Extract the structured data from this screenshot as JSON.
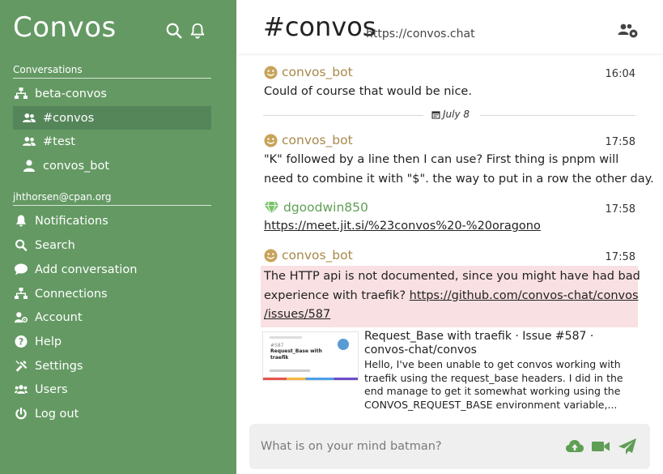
{
  "sidebar": {
    "logo": "Convos",
    "conversations_heading": "Conversations",
    "connection": "beta-convos",
    "conversations": [
      {
        "label": "#convos",
        "active": true
      },
      {
        "label": "#test",
        "active": false
      },
      {
        "label": "convos_bot",
        "active": false
      }
    ],
    "account_heading": "jhthorsen@cpan.org",
    "menu": [
      "Notifications",
      "Search",
      "Add conversation",
      "Connections",
      "Account",
      "Help",
      "Settings",
      "Users",
      "Log out"
    ]
  },
  "header": {
    "title": "#convos",
    "topic": "https://convos.chat"
  },
  "messages": [
    {
      "author": "convos_bot",
      "time": "16:04",
      "text": "Could of course that would be nice."
    },
    {
      "author": "convos_bot",
      "time": "17:58",
      "text_line1": "\"K\" followed by a line then I can use? First thing is pnpm will",
      "text_line2": "need to combine it with \"$\". the way to put in a row the other day."
    },
    {
      "author": "dgoodwin850",
      "time": "17:58",
      "link": "https://meet.jit.si/%23convos%20-%20oragono"
    },
    {
      "author": "convos_bot",
      "time": "17:58",
      "text_line1": "The HTTP api is not documented, since you might have had bad",
      "text_line2_prefix": "experience with traefik? ",
      "link_part1": "https://github.com/convos-chat/convos",
      "link_part2": "/issues/587"
    }
  ],
  "day_separator": "July 8",
  "preview": {
    "title": "Request_Base with traefik · Issue #587 · convos-chat/convos",
    "description": "Hello, I've been unable to get convos working with traefik using the request_base headers. I did in the end manage to get it somewhat working using the CONVOS_REQUEST_BASE environment variable,...",
    "thumb_number": "#587",
    "thumb_title": "Request_Base with traefik"
  },
  "composer": {
    "placeholder": "What is on your mind batman?"
  },
  "colors": {
    "sidebar_bg": "#649963",
    "sidebar_active": "#55865a",
    "bot_author": "#a7894a",
    "user_author": "#5f9e55",
    "highlight_bg": "#f9e0e2",
    "accent": "#5f9e55"
  }
}
